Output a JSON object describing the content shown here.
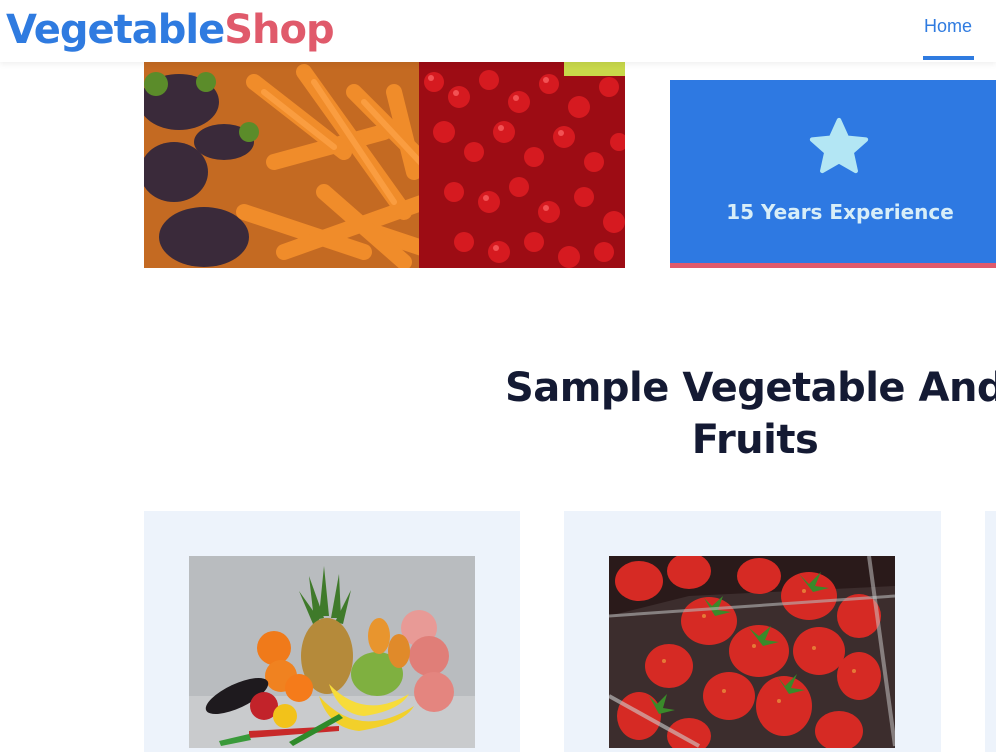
{
  "header": {
    "logo_part1": "Vegetable",
    "logo_part2": "Shop",
    "nav": [
      {
        "label": "Home",
        "active": true
      }
    ]
  },
  "hero": {
    "image_description": "carrots, cherries and eggplants",
    "experience": {
      "icon": "star-icon",
      "text": "15 Years Experience"
    }
  },
  "section": {
    "title": "Sample Vegetable And Fruits"
  },
  "cards": [
    {
      "image": "mixed fruits and vegetables with pineapple"
    },
    {
      "image": "strawberries in a plastic container"
    },
    {
      "image": ""
    }
  ],
  "colors": {
    "brand_blue": "#2f7be0",
    "brand_red": "#e05a6b",
    "experience_bg": "#2e79e2",
    "star": "#b3e6f4",
    "title": "#141a33",
    "card_bg": "#edf3fb"
  }
}
